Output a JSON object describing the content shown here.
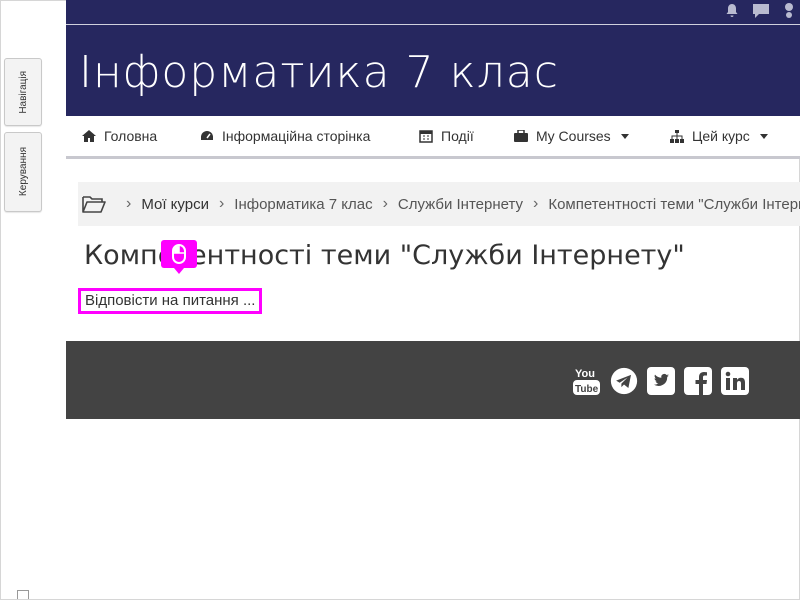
{
  "sidebar": {
    "nav_tab": "Навігація",
    "admin_tab": "Керування"
  },
  "header": {
    "site_title": "Інформатика 7 клас"
  },
  "topbar": {
    "icons": [
      "bell-icon",
      "chat-icon",
      "user-menu-icon"
    ]
  },
  "nav": {
    "items": [
      {
        "label": "Головна",
        "icon": "home-icon"
      },
      {
        "label": "Інформаційна сторінка",
        "icon": "dashboard-icon"
      },
      {
        "label": "Події",
        "icon": "calendar-icon"
      },
      {
        "label": "My Courses",
        "icon": "briefcase-icon",
        "dropdown": true
      },
      {
        "label": "Цей курс",
        "icon": "sitemap-icon",
        "dropdown": true
      }
    ]
  },
  "breadcrumb": {
    "items": [
      "Мої курси",
      "Інформатика 7 клас",
      "Служби Інтернету",
      "Компетентності теми \"Служби Інтернету\""
    ]
  },
  "page": {
    "heading": "Компетентності теми \"Служби Інтернету\"",
    "link_text": "Відповісти на питання ..."
  },
  "footer": {
    "social": [
      "youtube-icon",
      "telegram-icon",
      "twitter-icon",
      "facebook-icon",
      "linkedin-icon"
    ],
    "youtube_top": "You",
    "youtube_bottom": "Tube"
  },
  "colors": {
    "header_bg": "#26275f",
    "footer_bg": "#434343",
    "highlight": "#ff00ff"
  }
}
